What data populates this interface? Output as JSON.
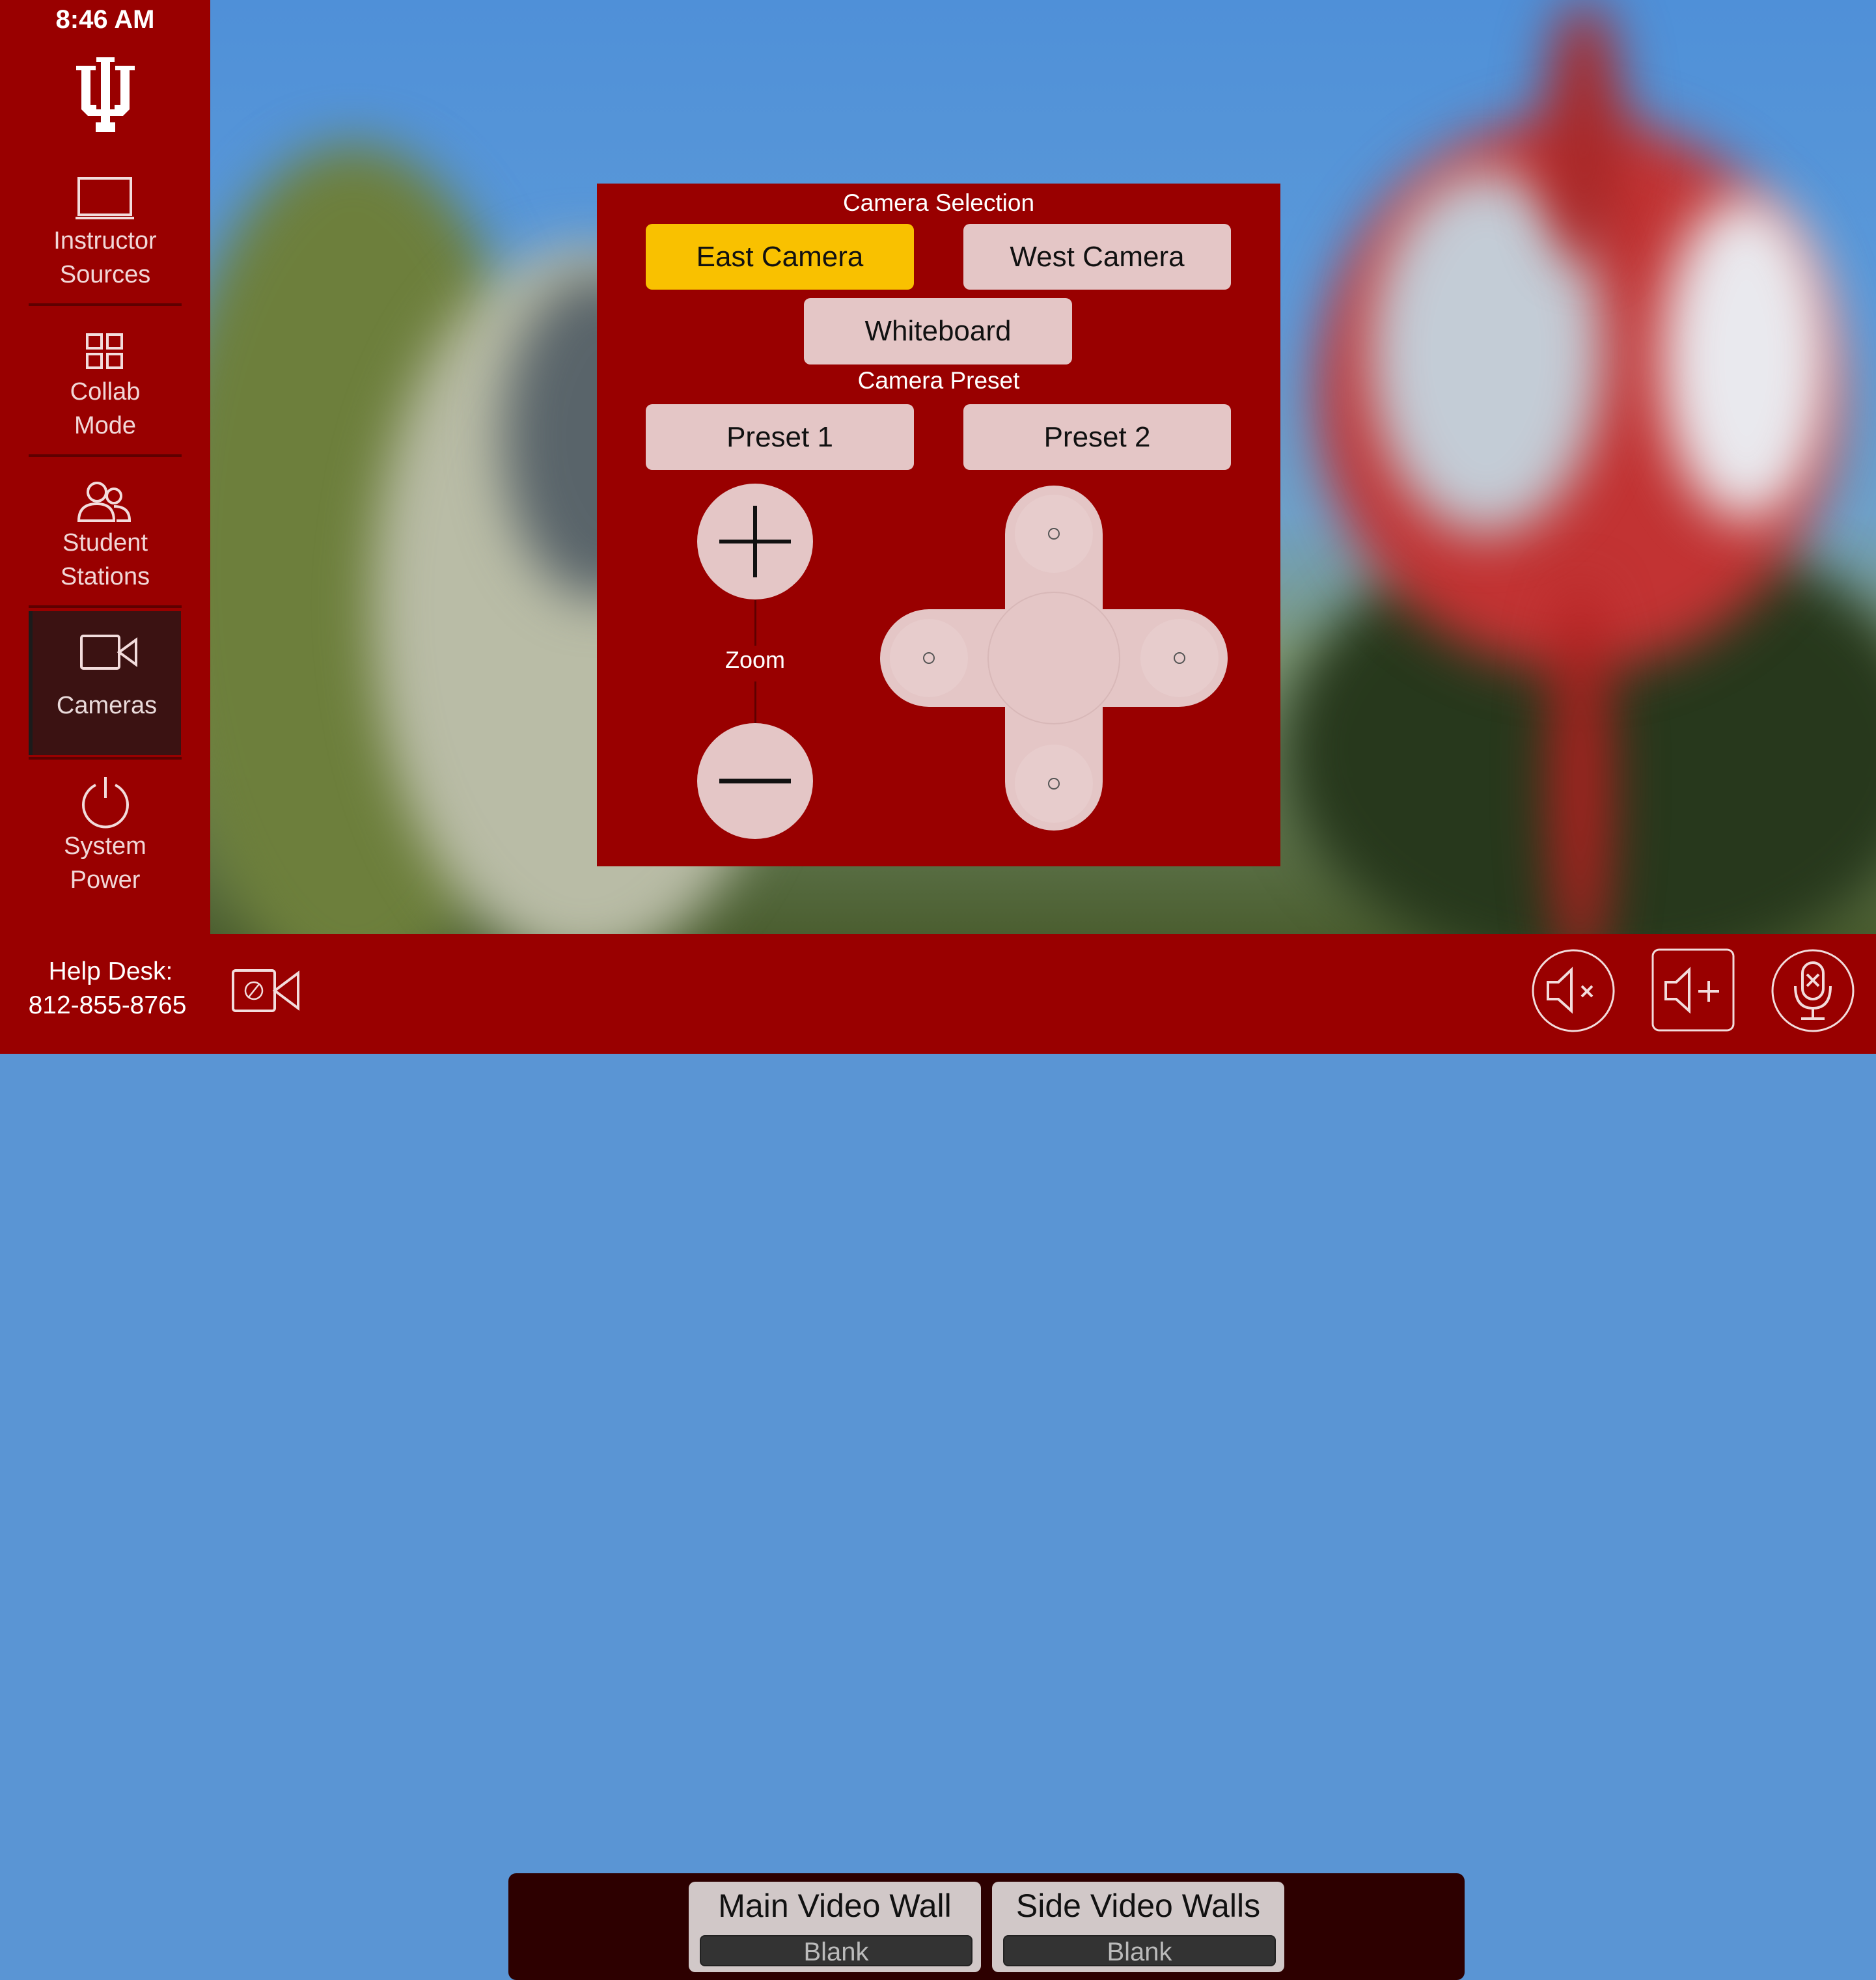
{
  "sidebar": {
    "time": "8:46 AM",
    "logo": "iu-trident-logo",
    "items": [
      {
        "icon": "laptop-icon",
        "line1": "Instructor",
        "line2": "Sources",
        "active": false
      },
      {
        "icon": "grid-icon",
        "line1": "Collab",
        "line2": "Mode",
        "active": false
      },
      {
        "icon": "users-icon",
        "line1": "Student",
        "line2": "Stations",
        "active": false
      },
      {
        "icon": "video-camera-icon",
        "line1": "Cameras",
        "line2": "",
        "active": true
      },
      {
        "icon": "power-icon",
        "line1": "System",
        "line2": "Power",
        "active": false
      }
    ]
  },
  "camera_panel": {
    "selection_title": "Camera Selection",
    "cameras": [
      {
        "label": "East Camera",
        "selected": true
      },
      {
        "label": "West Camera",
        "selected": false
      },
      {
        "label": "Whiteboard",
        "selected": false
      }
    ],
    "preset_title": "Camera Preset",
    "presets": [
      {
        "label": "Preset 1"
      },
      {
        "label": "Preset 2"
      }
    ],
    "zoom_label": "Zoom",
    "zoom_in_icon": "plus-icon",
    "zoom_out_icon": "minus-icon",
    "dpad_directions": [
      "up",
      "left",
      "right",
      "down"
    ]
  },
  "footer": {
    "help_desk_label": "Help Desk:",
    "help_desk_phone": "812-855-8765",
    "camera_privacy_icon": "camera-off-icon",
    "video_walls": [
      {
        "title": "Main Video Wall",
        "status": "Blank"
      },
      {
        "title": "Side Video Walls",
        "status": "Blank"
      }
    ],
    "audio_controls": [
      {
        "icon": "volume-mute-icon"
      },
      {
        "icon": "volume-up-icon"
      },
      {
        "icon": "mic-mute-icon"
      }
    ]
  },
  "colors": {
    "brand_red": "#990000",
    "selected_yellow": "#F9C100",
    "button_pink": "#E4C6C6",
    "active_nav": "#3B1212",
    "video_wall_panel": "#2D0000"
  }
}
